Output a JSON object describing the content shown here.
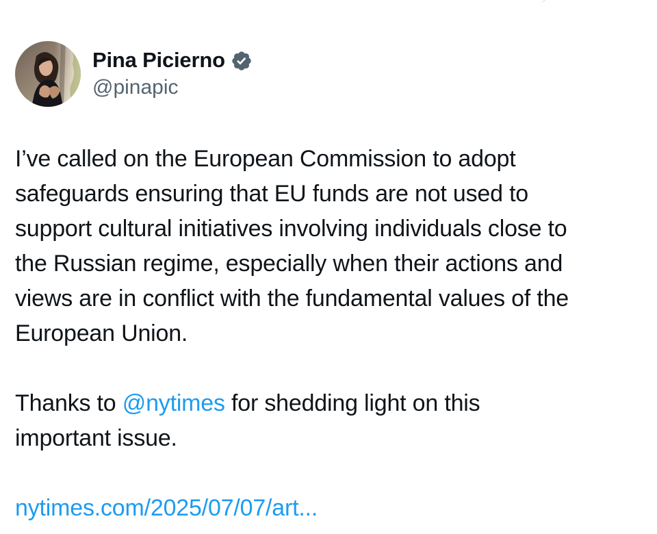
{
  "author": {
    "name": "Pina Picierno",
    "handle": "@pinapic",
    "avatar_icon": "profile-photo",
    "verified_icon": "verified-badge-icon",
    "verified_color": "#536471"
  },
  "tweet": {
    "paragraph1_lines": [
      "I’ve called on the European Commission to adopt",
      "safeguards ensuring that EU funds are not used to",
      "support cultural initiatives involving individuals close to",
      "the Russian regime, especially when their actions and",
      "views are in conflict with the fundamental values of the",
      "European Union."
    ],
    "paragraph2_prefix": "Thanks to ",
    "paragraph2_mention": "@nytimes",
    "paragraph2_suffix": " for shedding light on this",
    "paragraph2_line2": "important issue.",
    "link": "nytimes.com/2025/07/07/art..."
  },
  "colors": {
    "text": "#0f1419",
    "secondary": "#536471",
    "link": "#1d9bf0",
    "background": "#ffffff"
  }
}
